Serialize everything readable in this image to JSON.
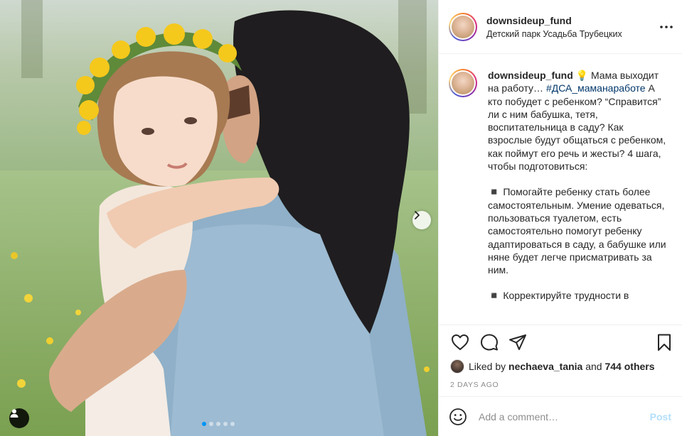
{
  "post": {
    "author": "downsideup_fund",
    "location": "Детский парк Усадьба Трубецких",
    "more_icon": "more-horizontal-icon",
    "carousel": {
      "slide_count": 5,
      "active_index": 0
    }
  },
  "caption": {
    "username": "downsideup_fund",
    "emoji": "💡",
    "lead": " Мама выходит на работу… ",
    "hashtag": "#ДСА_мамаонаработе",
    "hashtag_text": "#ДСА_маманаработе",
    "p1_rest": " А кто побудет с ребенком? “Справится” ли с ним бабушка, тетя, воспитательница в саду? Как взрослые будут общаться с ребенком, как поймут его речь и жесты? 4 шага, чтобы подготовиться:",
    "p2": "◾️ Помогайте ребенку стать более самостоятельным. Умение одеваться, пользоваться туалетом, есть самостоятельно помогут ребенку адаптироваться в саду, а бабушке или няне будет легче присматривать за ним.",
    "p3": "◾️ Корректируйте трудности в"
  },
  "actions": {
    "like_icon": "heart-icon",
    "comment_icon": "comment-icon",
    "share_icon": "paper-plane-icon",
    "save_icon": "bookmark-icon"
  },
  "likes": {
    "prefix": "Liked by ",
    "user": "nechaeva_tania",
    "middle": " and ",
    "others": "744 others"
  },
  "timestamp": "2 DAYS AGO",
  "comment": {
    "placeholder": "Add a comment…",
    "post_label": "Post"
  },
  "colors": {
    "hashtag": "#00376b",
    "post_disabled": "#b2dffc",
    "carousel_active_dot": "#0095f6"
  }
}
